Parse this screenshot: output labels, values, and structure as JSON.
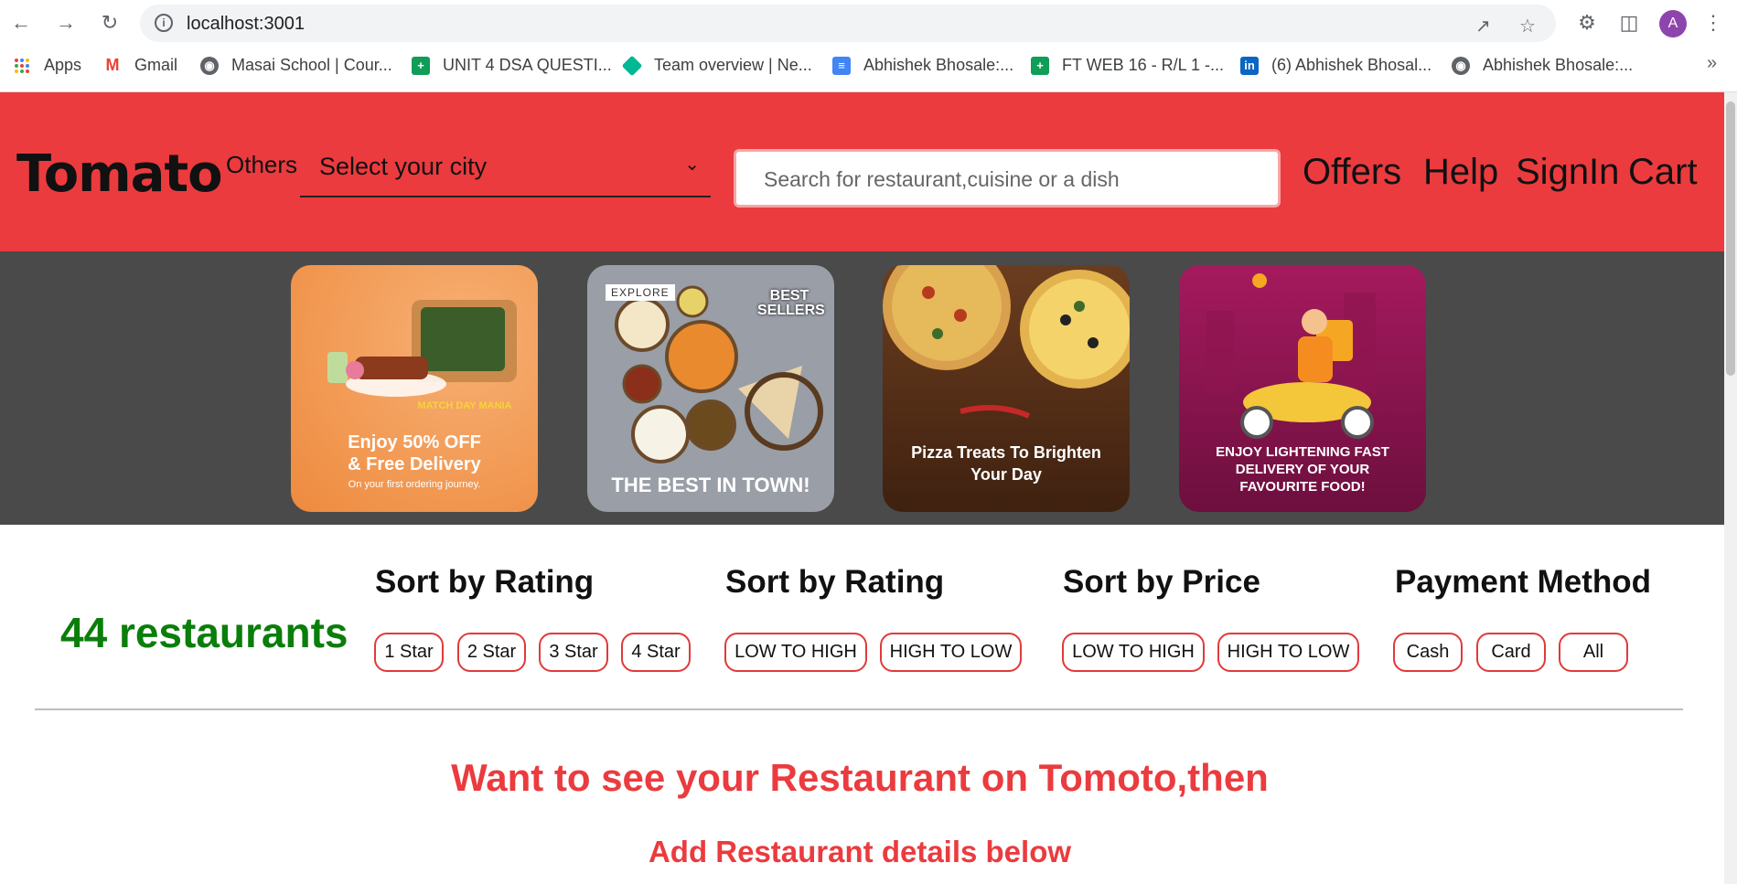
{
  "browser": {
    "url": "localhost:3001",
    "profile_initial": "A",
    "bookmarks": [
      {
        "label": "Apps",
        "icon": "apps-grid-icon",
        "color": "#4285f4"
      },
      {
        "label": "Gmail",
        "icon": "gmail-icon",
        "color": "#ea4335"
      },
      {
        "label": "Masai School | Cour...",
        "icon": "globe-icon",
        "color": "#5f6368"
      },
      {
        "label": "UNIT 4 DSA QUESTI...",
        "icon": "sheets-icon",
        "color": "#0f9d58"
      },
      {
        "label": "Team overview | Ne...",
        "icon": "diamond-icon",
        "color": "#00b894"
      },
      {
        "label": "Abhishek Bhosale:...",
        "icon": "docs-icon",
        "color": "#4285f4"
      },
      {
        "label": "FT WEB 16 - R/L 1 -...",
        "icon": "sheets-icon",
        "color": "#0f9d58"
      },
      {
        "label": "(6) Abhishek Bhosal...",
        "icon": "linkedin-icon",
        "color": "#0a66c2"
      },
      {
        "label": "Abhishek Bhosale:...",
        "icon": "globe-icon",
        "color": "#5f6368"
      }
    ],
    "more": "»"
  },
  "header": {
    "logo": "Tomato",
    "others": "Others",
    "city_select": "Select your city",
    "search_placeholder": "Search for restaurant,cuisine or a dish",
    "nav": [
      "Offers",
      "Help",
      "SignIn",
      "Cart"
    ],
    "bg_color": "#eb3b3e"
  },
  "banner": {
    "cards": [
      {
        "tag": "MATCH DAY MANIA",
        "line1": "Enjoy 50% OFF",
        "line2": "& Free Delivery",
        "line3": "On your first ordering journey."
      },
      {
        "tag": "EXPLORE",
        "badge": "BEST SELLERS",
        "line1": "THE BEST IN TOWN!"
      },
      {
        "line1": "Pizza Treats To Brighten",
        "line2": "Your Day"
      },
      {
        "line1": "ENJOY LIGHTENING FAST",
        "line2": "DELIVERY OF YOUR",
        "line3": "FAVOURITE FOOD!"
      }
    ]
  },
  "filters": {
    "count": "44 restaurants",
    "groups": [
      {
        "title": "Sort by Rating",
        "options": [
          "1 Star",
          "2 Star",
          "3 Star",
          "4 Star"
        ]
      },
      {
        "title": "Sort by Rating",
        "options": [
          "LOW TO HIGH",
          "HIGH TO LOW"
        ]
      },
      {
        "title": "Sort by Price",
        "options": [
          "LOW TO HIGH",
          "HIGH TO LOW"
        ]
      },
      {
        "title": "Payment Method",
        "options": [
          "Cash",
          "Card",
          "All"
        ]
      }
    ]
  },
  "cta": {
    "line1": "Want to see your Restaurant on Tomoto,then",
    "line2": "Add Restaurant details below"
  }
}
